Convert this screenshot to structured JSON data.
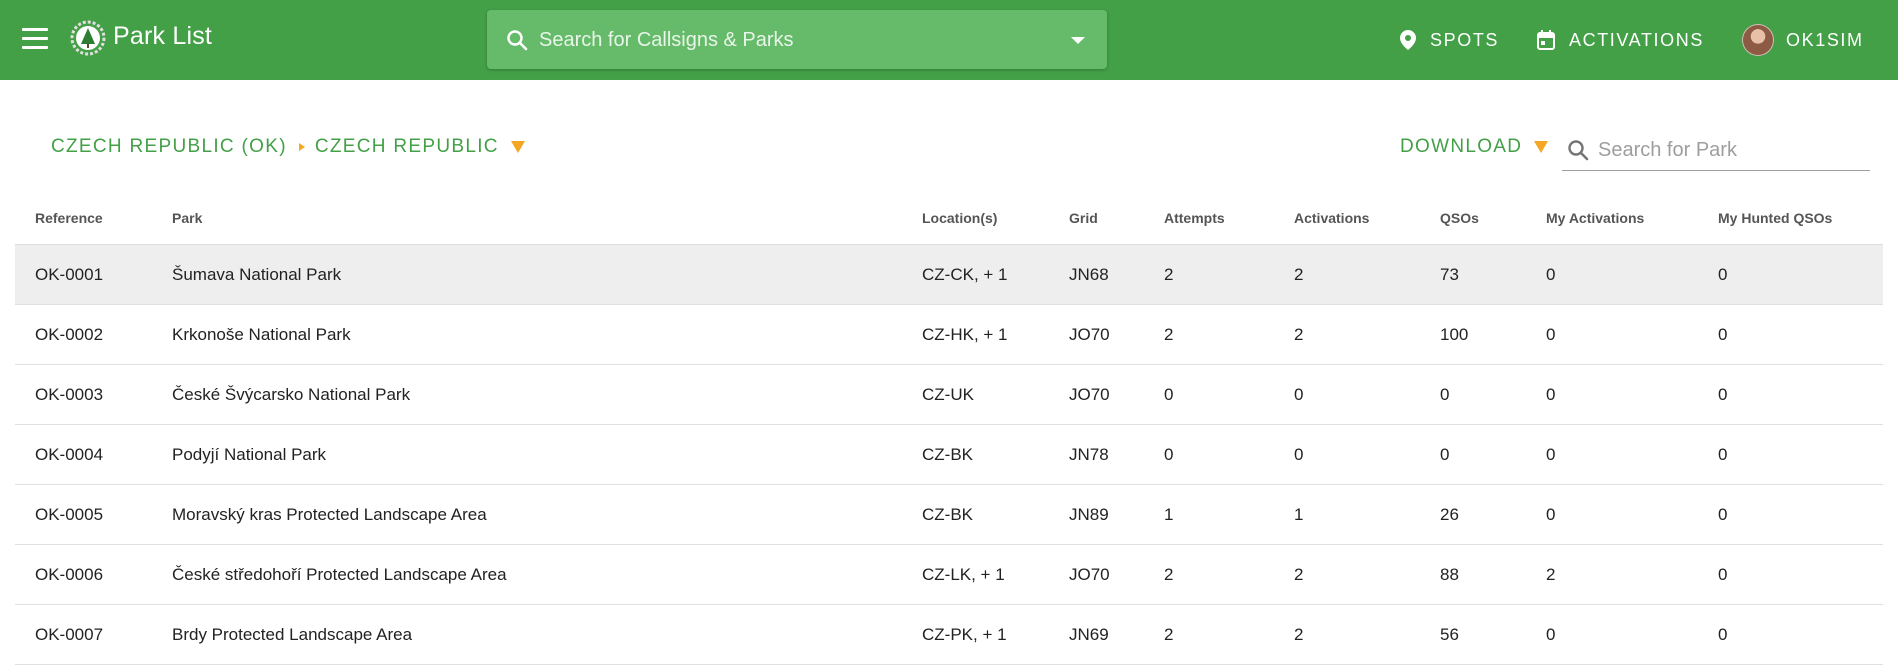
{
  "app": {
    "title": "Park List",
    "brand_color": "#43a047"
  },
  "header": {
    "search_placeholder": "Search for Callsigns & Parks",
    "nav": {
      "spots": "SPOTS",
      "activations": "ACTIVATIONS",
      "user": "OK1SIM"
    }
  },
  "breadcrumb": {
    "items": [
      "CZECH REPUBLIC (OK)",
      "CZECH REPUBLIC"
    ]
  },
  "toolbar": {
    "download_label": "DOWNLOAD",
    "park_search_placeholder": "Search for Park"
  },
  "table": {
    "headers": [
      "Reference",
      "Park",
      "Location(s)",
      "Grid",
      "Attempts",
      "Activations",
      "QSOs",
      "My Activations",
      "My Hunted QSOs"
    ],
    "rows": [
      [
        "OK-0001",
        "Šumava National Park",
        "CZ-CK, + 1",
        "JN68",
        "2",
        "2",
        "73",
        "0",
        "0"
      ],
      [
        "OK-0002",
        "Krkonoše National Park",
        "CZ-HK, + 1",
        "JO70",
        "2",
        "2",
        "100",
        "0",
        "0"
      ],
      [
        "OK-0003",
        "České Švýcarsko National Park",
        "CZ-UK",
        "JO70",
        "0",
        "0",
        "0",
        "0",
        "0"
      ],
      [
        "OK-0004",
        "Podyjí National Park",
        "CZ-BK",
        "JN78",
        "0",
        "0",
        "0",
        "0",
        "0"
      ],
      [
        "OK-0005",
        "Moravský kras Protected Landscape Area",
        "CZ-BK",
        "JN89",
        "1",
        "1",
        "26",
        "0",
        "0"
      ],
      [
        "OK-0006",
        "České středohoří Protected Landscape Area",
        "CZ-LK, + 1",
        "JO70",
        "2",
        "2",
        "88",
        "2",
        "0"
      ],
      [
        "OK-0007",
        "Brdy Protected Landscape Area",
        "CZ-PK, + 1",
        "JN69",
        "2",
        "2",
        "56",
        "0",
        "0"
      ]
    ]
  }
}
